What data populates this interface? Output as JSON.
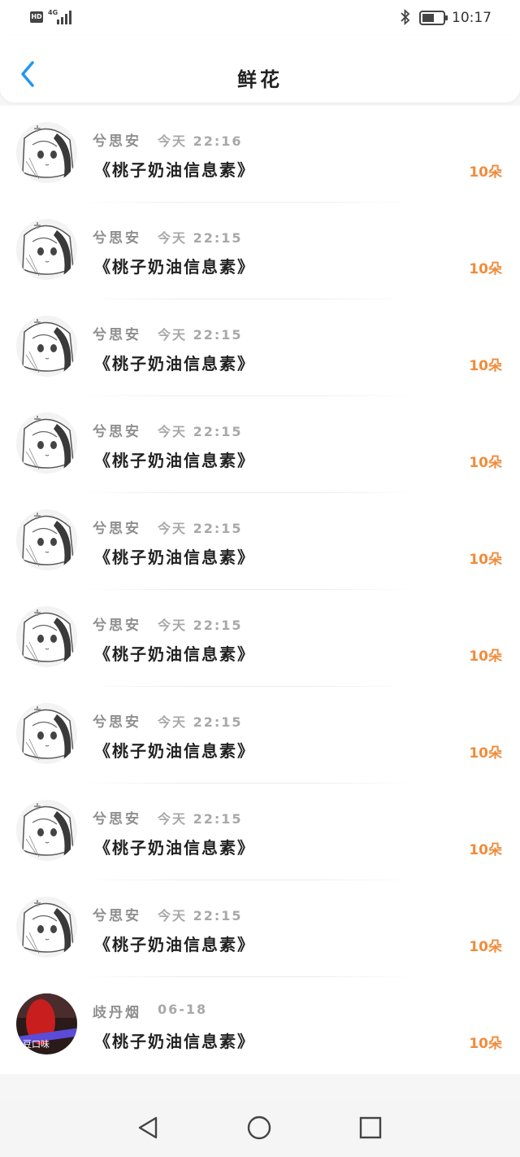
{
  "status_bar": {
    "hd": "HD",
    "network": "4G",
    "time": "10:17"
  },
  "header": {
    "title": "鲜花"
  },
  "records": [
    {
      "name": "兮思安",
      "time": "今天 22:16",
      "gift": "《桃子奶油信息素》",
      "count": "10朵",
      "avatar": "anime-avatar"
    },
    {
      "name": "兮思安",
      "time": "今天 22:15",
      "gift": "《桃子奶油信息素》",
      "count": "10朵",
      "avatar": "anime-avatar"
    },
    {
      "name": "兮思安",
      "time": "今天 22:15",
      "gift": "《桃子奶油信息素》",
      "count": "10朵",
      "avatar": "anime-avatar"
    },
    {
      "name": "兮思安",
      "time": "今天 22:15",
      "gift": "《桃子奶油信息素》",
      "count": "10朵",
      "avatar": "anime-avatar"
    },
    {
      "name": "兮思安",
      "time": "今天 22:15",
      "gift": "《桃子奶油信息素》",
      "count": "10朵",
      "avatar": "anime-avatar"
    },
    {
      "name": "兮思安",
      "time": "今天 22:15",
      "gift": "《桃子奶油信息素》",
      "count": "10朵",
      "avatar": "anime-avatar"
    },
    {
      "name": "兮思安",
      "time": "今天 22:15",
      "gift": "《桃子奶油信息素》",
      "count": "10朵",
      "avatar": "anime-avatar"
    },
    {
      "name": "兮思安",
      "time": "今天 22:15",
      "gift": "《桃子奶油信息素》",
      "count": "10朵",
      "avatar": "anime-avatar"
    },
    {
      "name": "兮思安",
      "time": "今天 22:15",
      "gift": "《桃子奶油信息素》",
      "count": "10朵",
      "avatar": "anime-avatar"
    },
    {
      "name": "歧丹烟",
      "time": "06-18",
      "gift": "《桃子奶油信息素》",
      "count": "10朵",
      "avatar": "photo-avatar",
      "avatar_text": "豆口味"
    }
  ],
  "colors": {
    "accent": "#2196f3",
    "count": "#f08c3b",
    "name": "#8f8f8f",
    "time": "#a8a8a8"
  },
  "icons": {
    "back": "chevron-left-icon",
    "nav_back": "triangle-back-icon",
    "nav_home": "circle-home-icon",
    "nav_recent": "square-recents-icon"
  }
}
